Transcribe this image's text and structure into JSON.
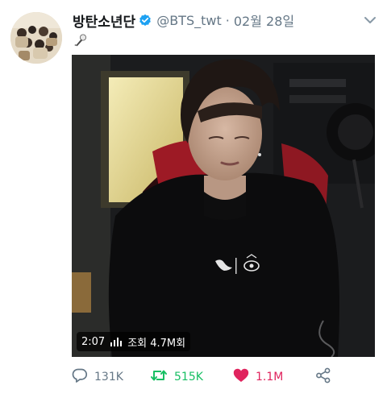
{
  "tweet": {
    "display_name": "방탄소년단",
    "handle": "@BTS_twt",
    "separator": "·",
    "date": "02월 28일"
  },
  "video": {
    "duration": "2:07",
    "views": "조회 4.7M회"
  },
  "actions": {
    "reply_count": "131K",
    "retweet_count": "515K",
    "like_count": "1.1M"
  },
  "icons": {
    "verified": "verified-badge-icon",
    "menu": "chevron-down-icon",
    "emoji": "microphone-icon",
    "views": "signal-bars-icon",
    "reply": "speech-bubble-icon",
    "retweet": "retweet-icon",
    "like": "heart-icon",
    "share": "share-icon"
  },
  "colors": {
    "verified": "#1da1f2",
    "retweet": "#17bf63",
    "like": "#e0245e",
    "muted": "#657786"
  }
}
